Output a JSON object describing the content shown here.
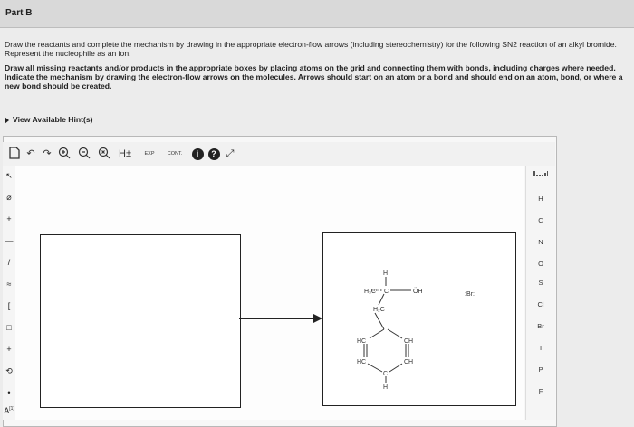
{
  "part": {
    "title": "Part B"
  },
  "instructions": {
    "line1": "Draw the reactants and complete the mechanism by drawing in the appropriate electron-flow arrows (including stereochemistry) for the following SN2 reaction of an alkyl bromide. Represent the nucleophile as an ion.",
    "line2": "Draw all missing reactants and/or products in the appropriate boxes by placing atoms on the grid and connecting them with bonds, including charges where needed. Indicate the mechanism by drawing the electron-flow arrows on the molecules. Arrows should start on an atom or a bond and should end on an atom, bond, or where a new bond should be created."
  },
  "hint": {
    "label": "View Available Hint(s)"
  },
  "toolbar": {
    "h_label": "H±",
    "exp_label": "EXP",
    "cont_label": "CONT.",
    "info_label": "i",
    "help_label": "?"
  },
  "left_tools": [
    "↖",
    "⌀",
    "+",
    "—",
    "/",
    "≈",
    "[",
    "□",
    "+",
    "⟲",
    "•",
    "A"
  ],
  "left_tools_badge": "[1]",
  "elements": [
    "H",
    "C",
    "N",
    "O",
    "S",
    "Cl",
    "Br",
    "I",
    "P",
    "F"
  ],
  "molecule": {
    "h_top": "H",
    "h3c_left": "H₃C",
    "center": "C",
    "oh": "ÖH",
    "h2c": "H₂C",
    "hc1": "HC",
    "ch1": "CH",
    "hc2": "HC",
    "ch2": "CH",
    "c_bottom": "C",
    "h_bottom": "H"
  },
  "bromide": {
    "label": ":Br:"
  }
}
